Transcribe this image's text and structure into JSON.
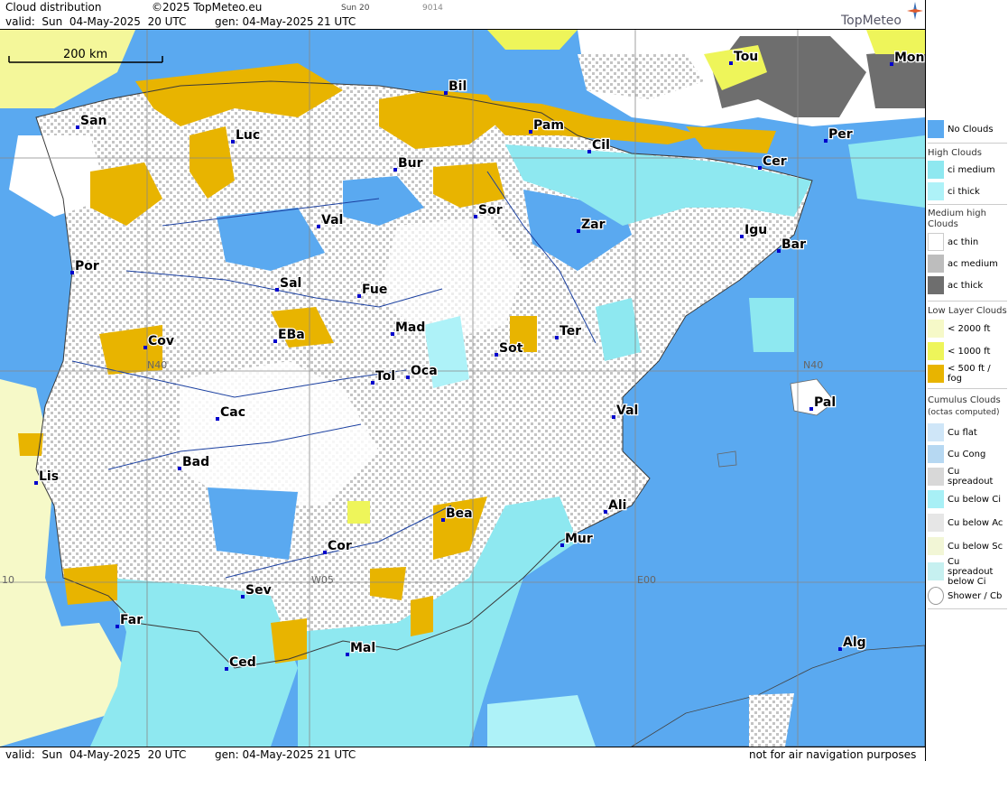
{
  "header": {
    "title": "Cloud distribution",
    "copyright": "©2025 TopMeteo.eu",
    "run": "Sun 20",
    "code": "9014",
    "valid": "valid:  Sun  04-May-2025  20 UTC",
    "gen": "gen: 04-May-2025 21 UTC",
    "brand": "TopMeteo"
  },
  "footer": {
    "valid": "valid:  Sun  04-May-2025  20 UTC",
    "gen": "gen: 04-May-2025 21 UTC",
    "disclaimer": "not for air navigation purposes"
  },
  "map": {
    "scale_label": "200 km",
    "grid_labels": {
      "n40_left": "N40",
      "n40_right": "N40",
      "w05": "W05",
      "e00": "E00",
      "w10": "10"
    },
    "cities": [
      {
        "code": "San"
      },
      {
        "code": "Luc"
      },
      {
        "code": "Bil"
      },
      {
        "code": "Pam"
      },
      {
        "code": "Tou"
      },
      {
        "code": "Mon"
      },
      {
        "code": "Per"
      },
      {
        "code": "Cil"
      },
      {
        "code": "Cer"
      },
      {
        "code": "Bur"
      },
      {
        "code": "Sor"
      },
      {
        "code": "Zar"
      },
      {
        "code": "Igu"
      },
      {
        "code": "Bar"
      },
      {
        "code": "Val"
      },
      {
        "code": "Por"
      },
      {
        "code": "Sal"
      },
      {
        "code": "Fue"
      },
      {
        "code": "Cov"
      },
      {
        "code": "EBa"
      },
      {
        "code": "Mad"
      },
      {
        "code": "Sot"
      },
      {
        "code": "Ter"
      },
      {
        "code": "Tol"
      },
      {
        "code": "Oca"
      },
      {
        "code": "Cac"
      },
      {
        "code": "Pal"
      },
      {
        "code": "Val"
      },
      {
        "code": "Bad"
      },
      {
        "code": "Lis"
      },
      {
        "code": "Bea"
      },
      {
        "code": "Ali"
      },
      {
        "code": "Mur"
      },
      {
        "code": "Cor"
      },
      {
        "code": "Sev"
      },
      {
        "code": "Far"
      },
      {
        "code": "Mal"
      },
      {
        "code": "Alg"
      },
      {
        "code": "Ced"
      }
    ]
  },
  "legend": {
    "no_clouds": "No Clouds",
    "high_clouds": "High Clouds",
    "ci_medium": "ci medium",
    "ci_thick": "ci thick",
    "medium_high": "Medium high Clouds",
    "ac_thin": "ac thin",
    "ac_medium": "ac medium",
    "ac_thick": "ac thick",
    "low_layer": "Low Layer Clouds",
    "lt2000": "< 2000 ft",
    "lt1000": "< 1000 ft",
    "lt500": "< 500 ft / fog",
    "cumulus": "Cumulus Clouds",
    "octas": "(octas computed)",
    "cu_flat": "Cu flat",
    "cu_cong": "Cu Cong",
    "cu_spreadout": "Cu spreadout",
    "cu_below_ci": "Cu below Ci",
    "cu_below_ac": "Cu below Ac",
    "cu_below_sc": "Cu below Sc",
    "cu_spreadout_below_ci": "Cu spreadout below Ci",
    "shower_cb": "Shower / Cb"
  },
  "colors": {
    "sea_no_clouds": "#5aa9f0",
    "ci_medium": "#8ee8f0",
    "ci_thick": "#aef2f8",
    "ac_thin": "#ffffff",
    "ac_medium": "#bdbdbd",
    "ac_thick": "#6e6e6e",
    "low_2000": "#f6f9c8",
    "low_1000": "#eef55a",
    "fog_500": "#e8b400",
    "city_marker": "#0000cc",
    "rivers": "#1a3fa0"
  }
}
